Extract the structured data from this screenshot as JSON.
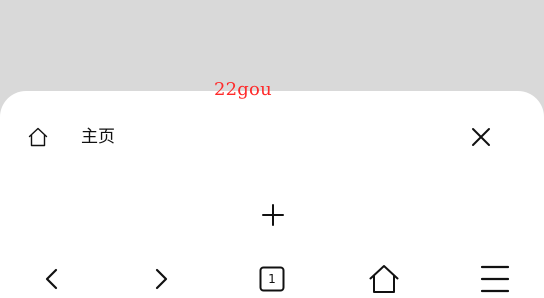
{
  "watermark": "22gou",
  "tab": {
    "title": "主页",
    "icon": "home-icon",
    "close_icon": "close-icon"
  },
  "new_tab": {
    "icon": "plus-icon"
  },
  "toolbar": {
    "back_icon": "chevron-left-icon",
    "forward_icon": "chevron-right-icon",
    "tab_count": "1",
    "home_icon": "home-icon",
    "menu_icon": "menu-icon"
  },
  "colors": {
    "background": "#d9d9d9",
    "sheet": "#ffffff",
    "watermark": "#ff2a2a",
    "icon": "#111111"
  }
}
